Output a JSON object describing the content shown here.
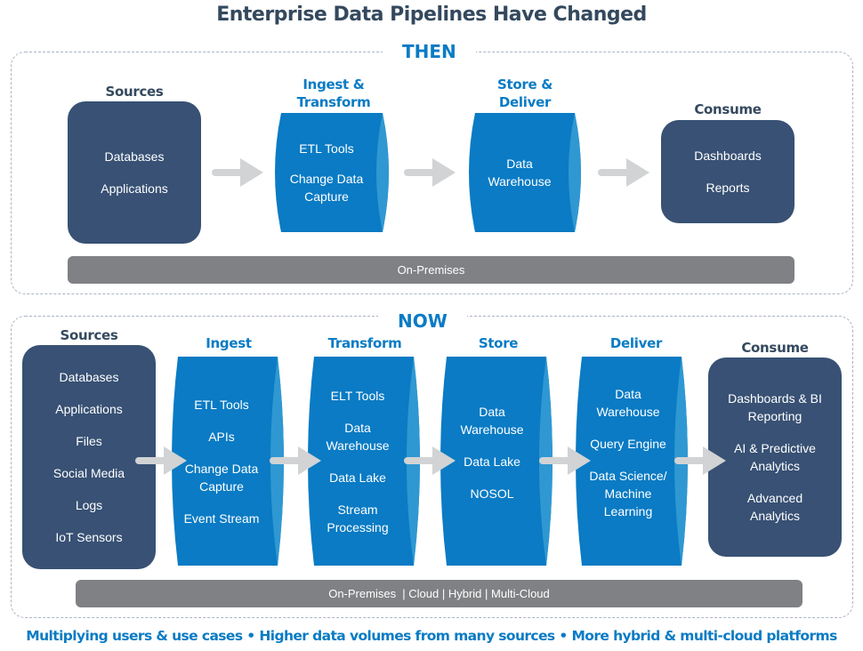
{
  "title": "Enterprise Data Pipelines Have Changed",
  "colors": {
    "dark_box": "#385174",
    "cylinder": "#0a7bc4",
    "cylinder_side": "#2f98d2",
    "arrow": "#d1d3d4",
    "env_bar": "#808184",
    "accent_text": "#0a7bc4",
    "dark_text": "#34495e"
  },
  "then": {
    "label": "THEN",
    "stages": [
      {
        "name": "Sources",
        "items": [
          "Databases",
          "Applications"
        ]
      },
      {
        "name": "Ingest & Transform",
        "items": [
          "ETL Tools",
          "Change Data Capture"
        ]
      },
      {
        "name": "Store & Deliver",
        "items": [
          "Data Warehouse"
        ]
      },
      {
        "name": "Consume",
        "items": [
          "Dashboards",
          "Reports"
        ]
      }
    ],
    "environment": "On-Premises"
  },
  "now": {
    "label": "NOW",
    "stages": [
      {
        "name": "Sources",
        "items": [
          "Databases",
          "Applications",
          "Files",
          "Social Media",
          "Logs",
          "IoT Sensors"
        ]
      },
      {
        "name": "Ingest",
        "items": [
          "ETL Tools",
          "APIs",
          "Change Data Capture",
          "Event Stream"
        ]
      },
      {
        "name": "Transform",
        "items": [
          "ELT Tools",
          "Data Warehouse",
          "Data Lake",
          "Stream Processing"
        ]
      },
      {
        "name": "Store",
        "items": [
          "Data Warehouse",
          "Data Lake",
          "NOSOL"
        ]
      },
      {
        "name": "Deliver",
        "items": [
          "Data Warehouse",
          "Query Engine",
          "Data Science/ Machine Learning"
        ]
      },
      {
        "name": "Consume",
        "items": [
          "Dashboards & BI Reporting",
          "AI & Predictive Analytics",
          "Advanced Analytics"
        ]
      }
    ],
    "environment": "On-Premises  | Cloud | Hybrid | Multi-Cloud"
  },
  "footer": "Multiplying users & use cases • Higher data volumes from many sources • More hybrid & multi-cloud platforms"
}
